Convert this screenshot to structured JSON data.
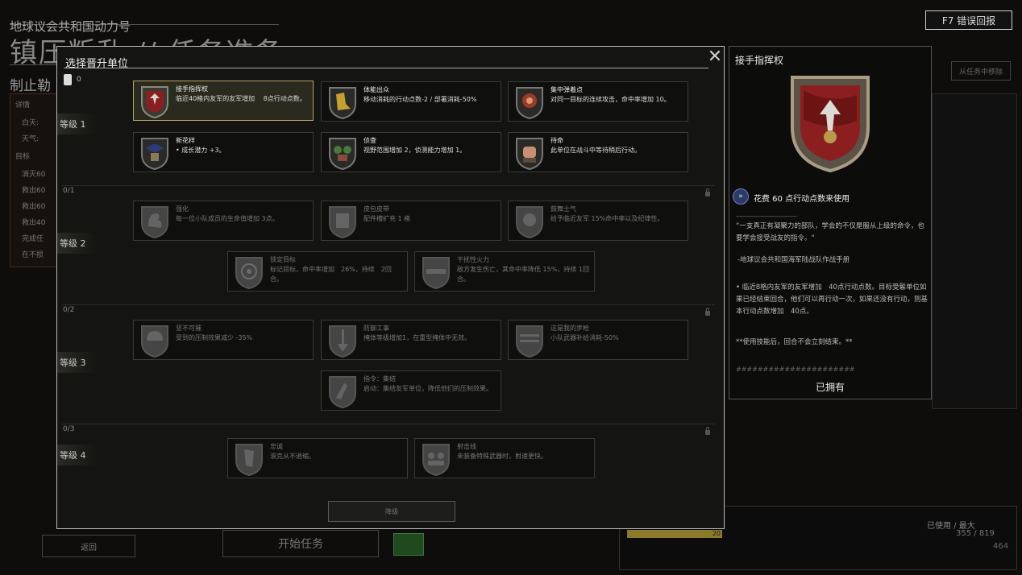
{
  "background": {
    "subtitle": "地球议会共和国动力号",
    "title": "镇压叛乱 // 任务准备",
    "sub_heading": "制止勒",
    "left_panel_lines": [
      "详情",
      "白天:",
      "天气:",
      "目标",
      "消灭60",
      "救出60",
      "救出60",
      "救出40",
      "完成任",
      "在不损"
    ],
    "report_button": "F7 错误回报",
    "remove_button": "从任务中移除",
    "back_button": "返回",
    "start_button": "开始任务",
    "usage_label": "已使用 / 最大",
    "usage_value": "355 / 819",
    "usage_value2": "464",
    "bar_value": "20"
  },
  "modal": {
    "title": "选择晋升单位",
    "points": "0",
    "demote_button": "降级",
    "tiers": [
      {
        "label": "等级 1",
        "count": ""
      },
      {
        "label": "等级 2",
        "count": "0/1"
      },
      {
        "label": "等级 3",
        "count": "0/2"
      },
      {
        "label": "等级 4",
        "count": "0/3"
      }
    ],
    "cards": [
      {
        "name": "接手指挥权",
        "desc": "临近40格内友军的友军增加　 8点行动点数。",
        "icon": "banner-icon",
        "state": "selected"
      },
      {
        "name": "体能出众",
        "desc": "移动消耗的行动点数-2 / 部署消耗-50%",
        "icon": "boot-icon",
        "state": "owned"
      },
      {
        "name": "集中弹着点",
        "desc": "对同一目标的连续攻击，命中率增加 10。",
        "icon": "target-soldier-icon",
        "state": "owned"
      },
      {
        "name": "新花样",
        "desc": "• 成长潜力 +3。",
        "icon": "graduation-cap-icon",
        "state": "owned"
      },
      {
        "name": "侦查",
        "desc": "视野范围增加 2，侦测能力增加 1。",
        "icon": "scout-icon",
        "state": "owned"
      },
      {
        "name": "待命",
        "desc": "此单位在战斗中等待稍后行动。",
        "icon": "fist-icon",
        "state": "owned"
      },
      {
        "name": "强化",
        "desc": "每一位小队成员的生命值增加 3点。",
        "icon": "muscle-icon",
        "state": "locked"
      },
      {
        "name": "皮包皮带",
        "desc": "配件槽扩充 1 格",
        "icon": "belt-pouch-icon",
        "state": "locked"
      },
      {
        "name": "鼓舞士气",
        "desc": "给予临近友军 15%命中率以及纪律性。",
        "icon": "morale-icon",
        "state": "locked"
      },
      {
        "name": "锁定目标",
        "desc": "标记目标，命中率增加　26%，持续　2回合。",
        "icon": "crosshair-icon",
        "state": "locked"
      },
      {
        "name": "干扰性火力",
        "desc": "敌方发生伤亡，其命中率降低 15%，持续 1回合。",
        "icon": "gun-icon",
        "state": "locked"
      },
      {
        "name": "坚不可摧",
        "desc": "受到的压制效果减少 -35%",
        "icon": "helmet-icon",
        "state": "locked"
      },
      {
        "name": "防御工事",
        "desc": "掩体等级增加1，在重型掩体中无效。",
        "icon": "shovel-icon",
        "state": "locked"
      },
      {
        "name": "这是我的步枪",
        "desc": "小队武器补给消耗-50%",
        "icon": "rifle-icon",
        "state": "locked"
      },
      {
        "name": "指令：集结",
        "desc": "启动：集结友军单位，降低他们的压制效果。",
        "icon": "rally-icon",
        "state": "locked"
      },
      {
        "name": "忠诚",
        "desc": "滚克从不退缩。",
        "icon": "loyalty-shield-icon",
        "state": "locked"
      },
      {
        "name": "射击线",
        "desc": "未装备特殊武器时，射速更快。",
        "icon": "firing-line-icon",
        "state": "locked"
      }
    ]
  },
  "detail": {
    "title": "接手指挥权",
    "cost_text": "花费 60 点行动点数来使用",
    "dashes": "----------------------------------------",
    "quote": "“一支真正有凝聚力的部队，学会的不仅是服从上级的命令，也要学会接受战友的指令。“",
    "attribution": "-地球议会共和国海军陆战队作战手册",
    "effect": "• 临近8格内友军的友军增加　40点行动点数。目标受鬈单位如果已经结束回合，他们可以再行动一次，如果还没有行动，则基本行动点数增加　40点。",
    "note": "**使用技能后，回合不会立刻结束。**",
    "hashes": "######################",
    "owned_label": "已拥有"
  },
  "colors": {
    "selected_border": "#b6a664",
    "panel_border": "#bcbcbc",
    "banner_red": "#8b1f1f"
  }
}
